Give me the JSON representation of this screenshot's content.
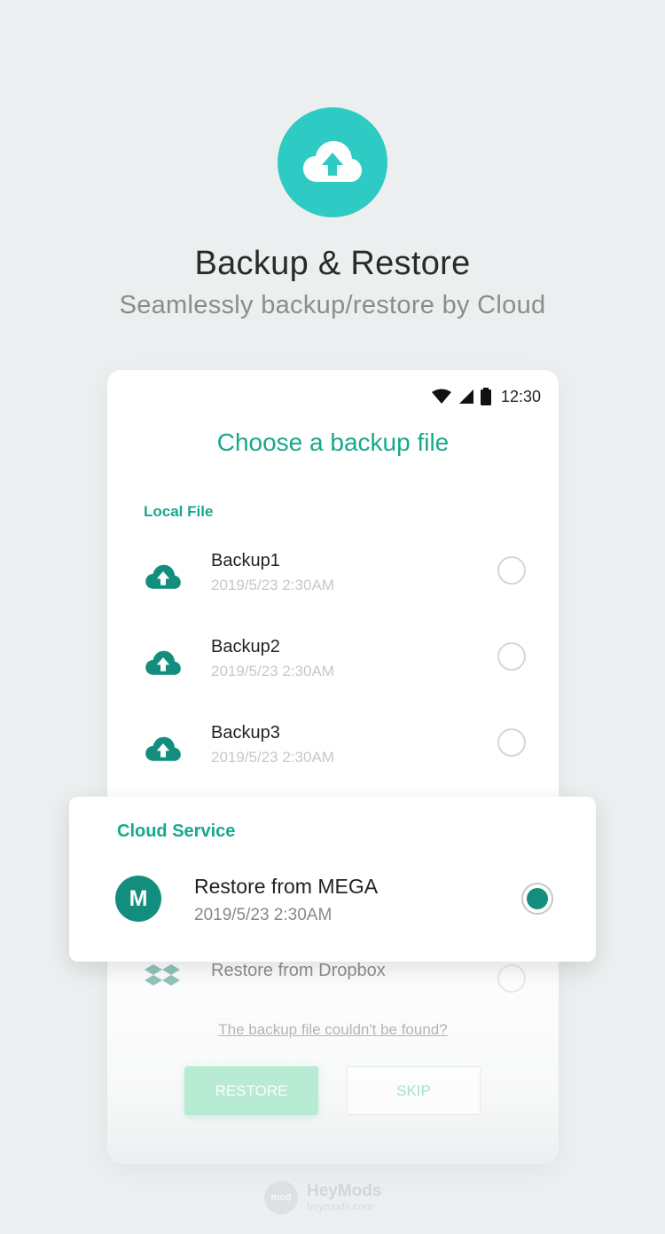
{
  "hero": {
    "icon": "cloud-upload-icon",
    "title": "Backup & Restore",
    "subtitle": "Seamlessly backup/restore by Cloud"
  },
  "status_bar": {
    "time": "12:30"
  },
  "dialog": {
    "title": "Choose a backup file",
    "local_section": "Local File",
    "local_files": [
      {
        "name": "Backup1",
        "date": "2019/5/23 2:30AM"
      },
      {
        "name": "Backup2",
        "date": "2019/5/23 2:30AM"
      },
      {
        "name": "Backup3",
        "date": "2019/5/23 2:30AM"
      }
    ],
    "dropbox_label": "Restore from Dropbox",
    "not_found_link": "The backup file couldn't be found?",
    "restore_button": "RESTORE",
    "skip_button": "SKIP"
  },
  "cloud_card": {
    "heading": "Cloud Service",
    "logo_letter": "M",
    "option_name": "Restore from MEGA",
    "option_date": "2019/5/23 2:30AM",
    "selected": true
  },
  "colors": {
    "accent": "#17a98a",
    "hero_circle": "#2ecac4",
    "mega_green": "#138e7e",
    "background": "#eceff0"
  },
  "watermark": {
    "badge": "mod",
    "brand": "HeyMods",
    "url": "heymods.com"
  }
}
